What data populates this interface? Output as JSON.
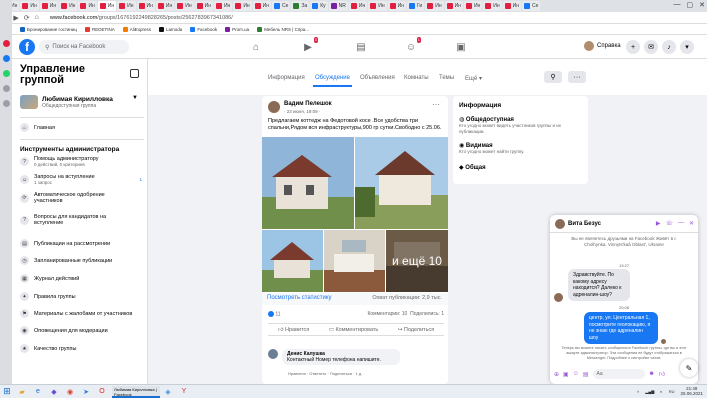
{
  "browser": {
    "tabs": [
      {
        "label": "Ин",
        "color": "#e41e3f"
      },
      {
        "label": "Ин",
        "color": "#e41e3f"
      },
      {
        "label": "Ин",
        "color": "#e41e3f"
      },
      {
        "label": "Ин",
        "color": "#e41e3f"
      },
      {
        "label": "Ин",
        "color": "#e41e3f"
      },
      {
        "label": "Ин",
        "color": "#e41e3f"
      },
      {
        "label": "Ин",
        "color": "#e41e3f"
      },
      {
        "label": "Ин",
        "color": "#e41e3f"
      },
      {
        "label": "Ин",
        "color": "#e41e3f"
      },
      {
        "label": "Ин",
        "color": "#e41e3f"
      },
      {
        "label": "Ин",
        "color": "#e41e3f"
      },
      {
        "label": "Ин",
        "color": "#e41e3f"
      },
      {
        "label": "Ин",
        "color": "#e41e3f"
      },
      {
        "label": "Ин",
        "color": "#e41e3f"
      },
      {
        "label": "Се",
        "color": "#1877f2"
      },
      {
        "label": "За",
        "color": "#2e7d32"
      },
      {
        "label": "Ку",
        "color": "#1877f2"
      },
      {
        "label": "NR",
        "color": "#7b1fa2"
      },
      {
        "label": "Ин",
        "color": "#e41e3f"
      },
      {
        "label": "Ин",
        "color": "#e41e3f"
      },
      {
        "label": "Ин",
        "color": "#e41e3f"
      },
      {
        "label": "Ги",
        "color": "#1877f2"
      },
      {
        "label": "Ин",
        "color": "#e41e3f"
      },
      {
        "label": "Ин",
        "color": "#e41e3f"
      },
      {
        "label": "Ин",
        "color": "#e41e3f"
      },
      {
        "label": "Ин",
        "color": "#e41e3f"
      },
      {
        "label": "Ин",
        "color": "#e41e3f"
      },
      {
        "label": "Се",
        "color": "#1877f2"
      }
    ],
    "url_host": "www.facebook.com",
    "url_path": "/groups/1676192249828265/posts/2562783967341086/",
    "bookmarks": [
      {
        "label": "Бронирование гостиниц",
        "color": "#1565c0"
      },
      {
        "label": "REDETINA",
        "color": "#e53935"
      },
      {
        "label": "AliExpress",
        "color": "#f57c00"
      },
      {
        "label": "Lamoda",
        "color": "#111111"
      },
      {
        "label": "Facebook",
        "color": "#1877f2"
      },
      {
        "label": "Prom.ua",
        "color": "#7b1fa2"
      },
      {
        "label": "Мебель NRS | Спра...",
        "color": "#2e7d32"
      }
    ]
  },
  "fb": {
    "search_placeholder": "Поиск на Facebook",
    "badge_video": "3",
    "badge_groups": "1",
    "user_name": "Справка"
  },
  "sidebar": {
    "title": "Управление группой",
    "group_name": "Любимая Кирилловка",
    "group_type": "Общедоступная группа",
    "main_label": "Главная",
    "section_title": "Инструменты администратора",
    "items": [
      {
        "label": "Помощь администратору",
        "sub": "0 действий, 0 критериев"
      },
      {
        "label": "Запросы на вступление",
        "sub": "1 запрос",
        "count": "1"
      },
      {
        "label": "Автоматическое одобрение участников",
        "sub": ""
      },
      {
        "label": "Вопросы для кандидатов на вступление",
        "sub": ""
      },
      {
        "label": "Публикации на рассмотрении",
        "sub": ""
      },
      {
        "label": "Запланированные публикации",
        "sub": ""
      },
      {
        "label": "Журнал действий",
        "sub": ""
      },
      {
        "label": "Правила группы",
        "sub": ""
      },
      {
        "label": "Материалы с жалобами от участников",
        "sub": ""
      },
      {
        "label": "Оповещения для модерации",
        "sub": ""
      },
      {
        "label": "Качество группы",
        "sub": ""
      }
    ]
  },
  "group_tabs": [
    "Информация",
    "Обсуждение",
    "Объявления",
    "Комнаты",
    "Темы",
    "Ещё"
  ],
  "post": {
    "author": "Вадим Пелешок",
    "date": "· 23 июня, 19:09 ·",
    "text": "Предлагаем коттедж на Федотовой косе .Все удобства три спальни,Рядом вся инфраструктуры,900 гр сутки.Свободно с 25.06.",
    "more_photos": "и ещё 10",
    "stats_link": "Посмотреть статистику",
    "reach": "Охват публикации: 2,9 тыс.",
    "likes": "11",
    "comments_count": "Комментарии: 10",
    "shares_count": "Поделились: 1",
    "actions": [
      "Нравится",
      "Комментировать",
      "Поделиться"
    ],
    "comment_author": "Денис Калушка",
    "comment_text": "Контактный Номер телефона напишите.",
    "comment_meta": "Нравится · Ответить · Поделиться · 1 д"
  },
  "info": {
    "title": "Информация",
    "rows": [
      {
        "label": "Общедоступная",
        "desc": "Кто угодно может видеть участников группы и их публикации."
      },
      {
        "label": "Видимая",
        "desc": "Кто угодно может найти группу."
      },
      {
        "label": "Общая",
        "desc": ""
      }
    ]
  },
  "chat": {
    "name": "Вита Безус",
    "system": "Вы не являетесь друзьями на Facebook Живёт в г. Cholhynka, Vinnyts'kaâ Oblast', Ukraine",
    "time1": "13:27",
    "msg_in": "Здравствуйте. По какому адресу находится? Далеко к адреналин-шоу?",
    "time2": "20:08",
    "msg_out": "центр, ул. Центральная 1, посмотрите геолокацию, я не знаю где адреналин шоу",
    "warning": "Теперь вы можете писать сообщения в Facebook группы, где вы и этот аккаунт администратор. Эти сообщения не будут отображаться в Messenger. Подробнее о настройке чатов.",
    "input_placeholder": "Аа"
  },
  "taskbar": {
    "app_label": "Любимая Кирилловка | Facebook",
    "time": "21:49",
    "date": "25.06.2021",
    "lang": "RU"
  }
}
